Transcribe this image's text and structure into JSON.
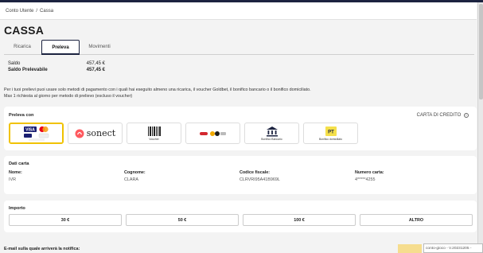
{
  "breadcrumb": {
    "items": [
      "Conto Utente",
      "Cassa"
    ],
    "separator": "/"
  },
  "page": {
    "title": "CASSA"
  },
  "tabs": [
    {
      "label": "Ricarica",
      "active": false
    },
    {
      "label": "Preleva",
      "active": true
    },
    {
      "label": "Movimenti",
      "active": false
    }
  ],
  "balance": {
    "saldo_label": "Saldo",
    "saldo_value": "457,45 €",
    "prelevabile_label": "Saldo Prelevabile",
    "prelevabile_value": "457,45 €"
  },
  "info": {
    "line1": "Per i tuoi prelievi puoi usare solo metodi di pagamento con i quali hai eseguito almeno una ricarica, il voucher Goldbet, il bonifico bancario o il bonifico domiciliato.",
    "line2": "Max 1 richiesta al giorno per metodo di prelievo (escluso il voucher)"
  },
  "preleva_con": {
    "label": "Preleva con",
    "right_label": "CARTA DI CREDITO",
    "methods": [
      {
        "name": "carta-di-credito",
        "caption": "VISA",
        "selected": true
      },
      {
        "name": "sonect",
        "caption": "sonect",
        "selected": false
      },
      {
        "name": "voucher",
        "caption": "Voucher",
        "selected": false
      },
      {
        "name": "skrill",
        "caption": "",
        "selected": false
      },
      {
        "name": "bonifico-bancario",
        "caption": "Bonifico Bancario",
        "selected": false
      },
      {
        "name": "bonifico-domiciliato",
        "caption": "Bonifico domiciliato",
        "selected": false
      }
    ]
  },
  "dati_carta": {
    "title": "Dati carta",
    "nome_label": "Nome:",
    "nome_value": "IVR",
    "cognome_label": "Cognome:",
    "cognome_value": "CLARA",
    "cf_label": "Codice fiscale:",
    "cf_value": "CLRVRI95A41B969L",
    "numero_label": "Numero carta:",
    "numero_value": "4*****4255"
  },
  "importo": {
    "title": "Importo",
    "amounts": [
      "30 €",
      "50 €",
      "100 €",
      "ALTRO"
    ]
  },
  "email": {
    "label": "E-mail sulla quale arriverà la notifica:"
  },
  "footer": {
    "version": "conto-gioco - V.20231205 -"
  },
  "colors": {
    "accent": "#f0c200",
    "dark": "#1c2340",
    "poste_yellow": "#f5e04a"
  }
}
